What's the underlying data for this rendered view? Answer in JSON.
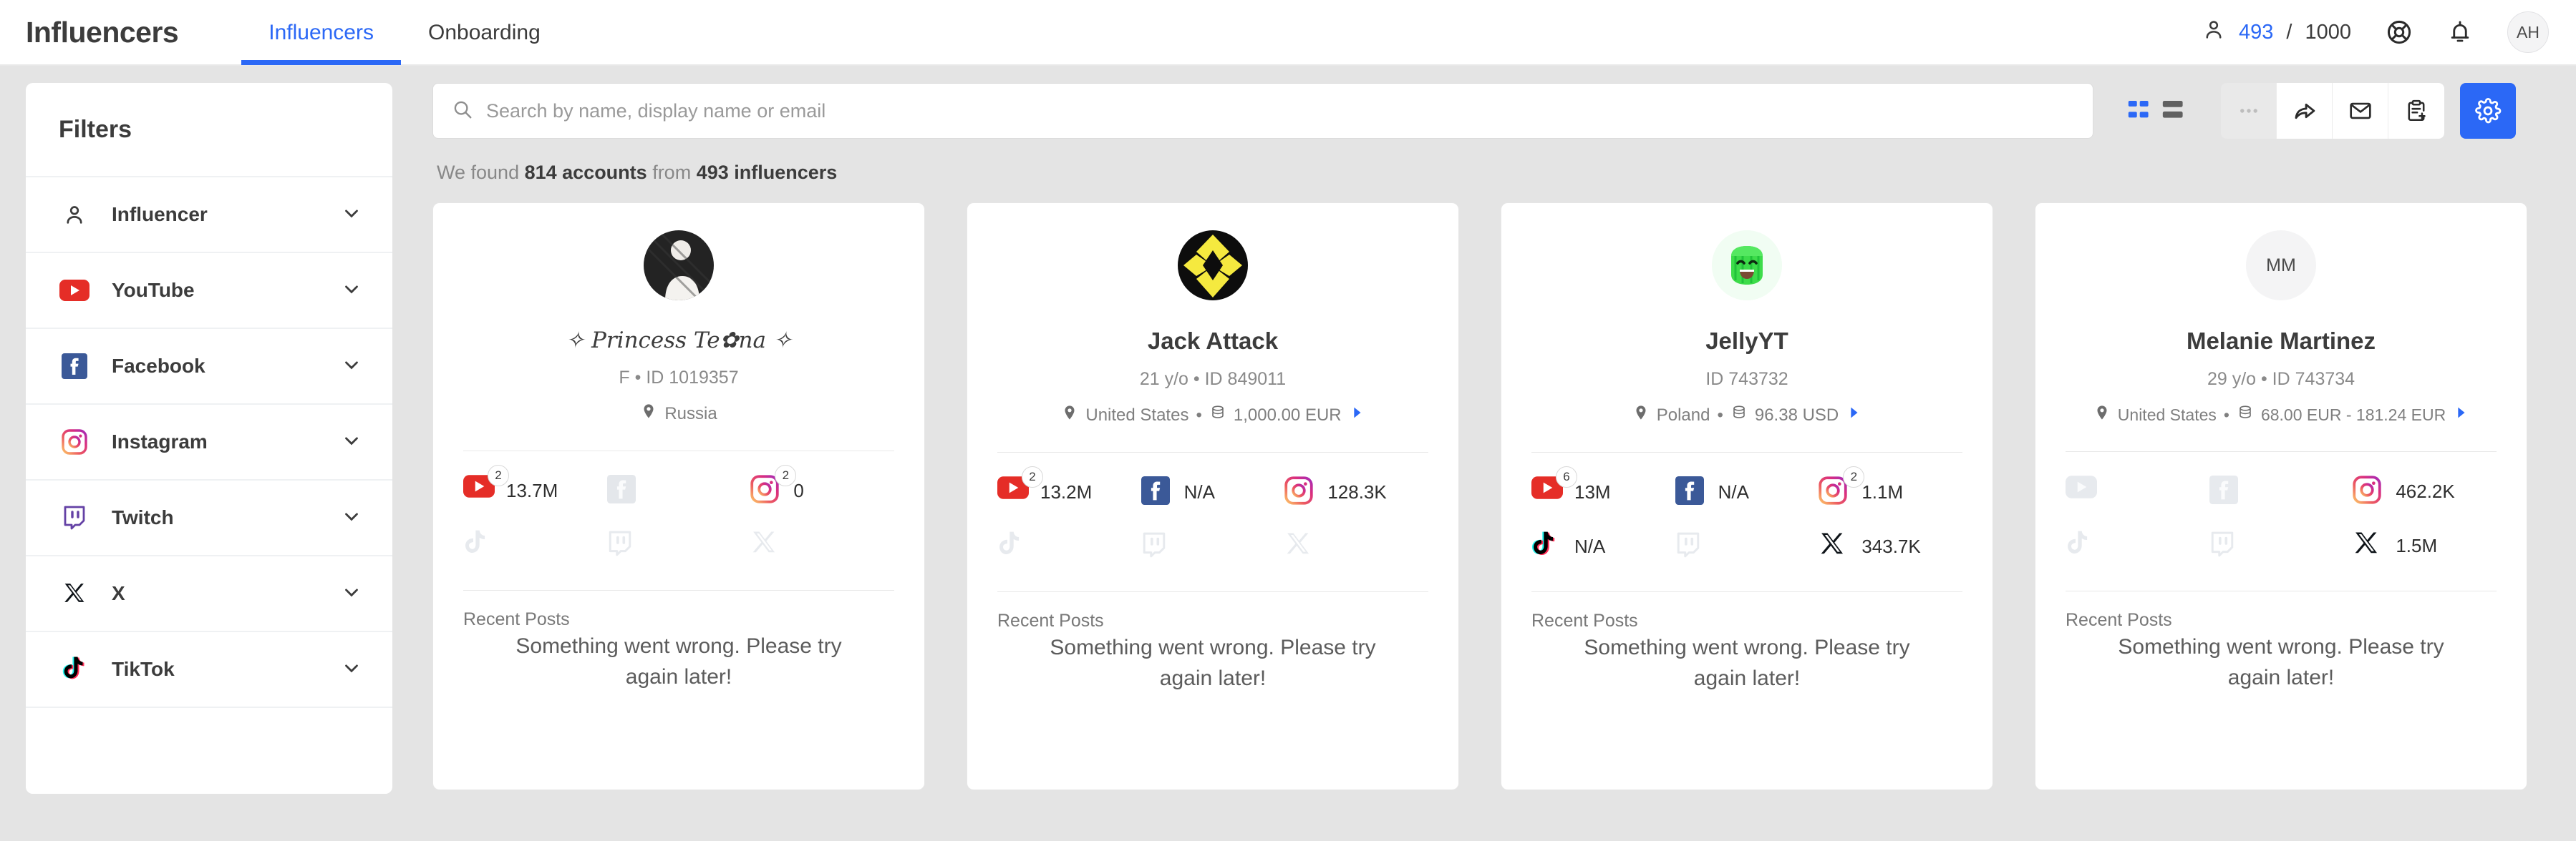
{
  "header": {
    "app_title": "Influencers",
    "tabs": [
      {
        "label": "Influencers",
        "active": true
      },
      {
        "label": "Onboarding",
        "active": false
      }
    ],
    "user_count_current": "493",
    "user_count_sep": "/",
    "user_count_total": "1000",
    "avatar_initials": "AH",
    "accent_color": "#2b68f6"
  },
  "sidebar": {
    "title": "Filters",
    "items": [
      {
        "label": "Influencer",
        "icon": "person-icon"
      },
      {
        "label": "YouTube",
        "icon": "youtube-icon"
      },
      {
        "label": "Facebook",
        "icon": "facebook-icon"
      },
      {
        "label": "Instagram",
        "icon": "instagram-icon"
      },
      {
        "label": "Twitch",
        "icon": "twitch-icon"
      },
      {
        "label": "X",
        "icon": "x-icon"
      },
      {
        "label": "TikTok",
        "icon": "tiktok-icon"
      }
    ]
  },
  "search": {
    "placeholder": "Search by name, display name or email",
    "value": ""
  },
  "toolbar": {
    "grid_view_label": "grid-view",
    "list_view_label": "list-view",
    "more_label": "more-options",
    "share_label": "share",
    "mail_label": "mail",
    "clipboard_label": "add-to-list",
    "settings_label": "settings"
  },
  "results": {
    "prefix": "We found ",
    "accounts": "814 accounts",
    "middle": " from ",
    "influencers": "493 influencers"
  },
  "cards": [
    {
      "name": "✧ Princess Te✿na ✧",
      "name_style": "script",
      "avatar_type": "photo",
      "avatar_initials": "",
      "sub": "F • ID 1019357",
      "location": "Russia",
      "price": "",
      "has_price": false,
      "has_arrow": false,
      "stats_row1": [
        {
          "platform": "youtube",
          "value": "13.7M",
          "badge": "2",
          "active": true
        },
        {
          "platform": "facebook",
          "value": "",
          "badge": "",
          "active": false
        },
        {
          "platform": "instagram",
          "value": "0",
          "badge": "2",
          "active": true
        }
      ],
      "stats_row2": [
        {
          "platform": "tiktok",
          "value": "",
          "badge": "",
          "active": false
        },
        {
          "platform": "twitch",
          "value": "",
          "badge": "",
          "active": false
        },
        {
          "platform": "x",
          "value": "",
          "badge": "",
          "active": false
        }
      ],
      "recent_posts_label": "Recent Posts",
      "recent_posts_body": "Something went wrong. Please try again later!"
    },
    {
      "name": "Jack Attack",
      "name_style": "normal",
      "avatar_type": "jack",
      "avatar_initials": "",
      "sub": "21 y/o • ID 849011",
      "location": "United States",
      "price": "1,000.00 EUR",
      "has_price": true,
      "has_arrow": true,
      "stats_row1": [
        {
          "platform": "youtube",
          "value": "13.2M",
          "badge": "2",
          "active": true
        },
        {
          "platform": "facebook",
          "value": "N/A",
          "badge": "",
          "active": true
        },
        {
          "platform": "instagram",
          "value": "128.3K",
          "badge": "",
          "active": true
        }
      ],
      "stats_row2": [
        {
          "platform": "tiktok",
          "value": "",
          "badge": "",
          "active": false
        },
        {
          "platform": "twitch",
          "value": "",
          "badge": "",
          "active": false
        },
        {
          "platform": "x",
          "value": "",
          "badge": "",
          "active": false
        }
      ],
      "recent_posts_label": "Recent Posts",
      "recent_posts_body": "Something went wrong. Please try again later!"
    },
    {
      "name": "JellyYT",
      "name_style": "normal",
      "avatar_type": "jelly",
      "avatar_initials": "",
      "sub": "ID 743732",
      "location": "Poland",
      "price": "96.38 USD",
      "has_price": true,
      "has_arrow": true,
      "stats_row1": [
        {
          "platform": "youtube",
          "value": "13M",
          "badge": "6",
          "active": true
        },
        {
          "platform": "facebook",
          "value": "N/A",
          "badge": "",
          "active": true
        },
        {
          "platform": "instagram",
          "value": "1.1M",
          "badge": "2",
          "active": true
        }
      ],
      "stats_row2": [
        {
          "platform": "tiktok",
          "value": "N/A",
          "badge": "",
          "active": true
        },
        {
          "platform": "twitch",
          "value": "",
          "badge": "",
          "active": false
        },
        {
          "platform": "x",
          "value": "343.7K",
          "badge": "",
          "active": true
        }
      ],
      "recent_posts_label": "Recent Posts",
      "recent_posts_body": "Something went wrong. Please try again later!"
    },
    {
      "name": "Melanie Martinez",
      "name_style": "normal",
      "avatar_type": "initials",
      "avatar_initials": "MM",
      "sub": "29 y/o • ID 743734",
      "location": "United States",
      "price": "68.00 EUR - 181.24 EUR",
      "has_price": true,
      "has_arrow": true,
      "stats_row1": [
        {
          "platform": "youtube",
          "value": "",
          "badge": "",
          "active": false
        },
        {
          "platform": "facebook",
          "value": "",
          "badge": "",
          "active": false
        },
        {
          "platform": "instagram",
          "value": "462.2K",
          "badge": "",
          "active": true
        }
      ],
      "stats_row2": [
        {
          "platform": "tiktok",
          "value": "",
          "badge": "",
          "active": false
        },
        {
          "platform": "twitch",
          "value": "",
          "badge": "",
          "active": false
        },
        {
          "platform": "x",
          "value": "1.5M",
          "badge": "",
          "active": true
        }
      ],
      "recent_posts_label": "Recent Posts",
      "recent_posts_body": "Something went wrong. Please try again later!"
    }
  ]
}
